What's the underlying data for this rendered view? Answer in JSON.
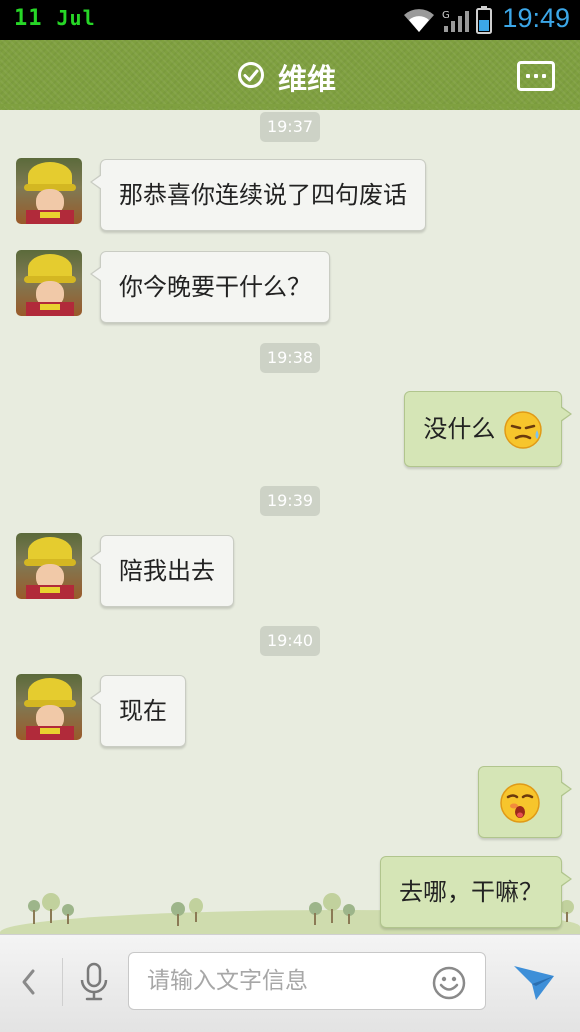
{
  "status_bar": {
    "day": "11",
    "month": "Jul",
    "time": "19:49",
    "icons": [
      "wifi-icon",
      "signal-icon",
      "battery-icon"
    ]
  },
  "header": {
    "contact_name": "维维",
    "status_icon": "online-check-icon",
    "menu_icon": "more-menu-icon",
    "background_color": "#7fa040"
  },
  "messages": {
    "timestamps": [
      "19:37",
      "19:38",
      "19:39",
      "19:40"
    ],
    "m1": {
      "side": "left",
      "text": "那恭喜你连续说了四句废话"
    },
    "m2": {
      "side": "left",
      "text": "你今晚要干什么？"
    },
    "m3": {
      "side": "right",
      "text": "没什么",
      "emoji": "sweating-smiley-icon"
    },
    "m4": {
      "side": "left",
      "text": "陪我出去"
    },
    "m5": {
      "side": "left",
      "text": "现在"
    },
    "m6": {
      "side": "right",
      "emoji": "surprised-smiley-icon"
    },
    "m7": {
      "side": "right",
      "text": "去哪，干嘛？"
    }
  },
  "input_bar": {
    "placeholder": "请输入文字信息",
    "value": "",
    "icons": [
      "back-chevron-icon",
      "mic-icon",
      "smiley-icon",
      "send-icon"
    ]
  },
  "colors": {
    "status_time": "#3ca7e8",
    "status_date": "#27d627",
    "sent_bubble": "#d5e5b6",
    "received_bubble": "#f4f5f2",
    "chat_background": "#e8ecdf"
  }
}
